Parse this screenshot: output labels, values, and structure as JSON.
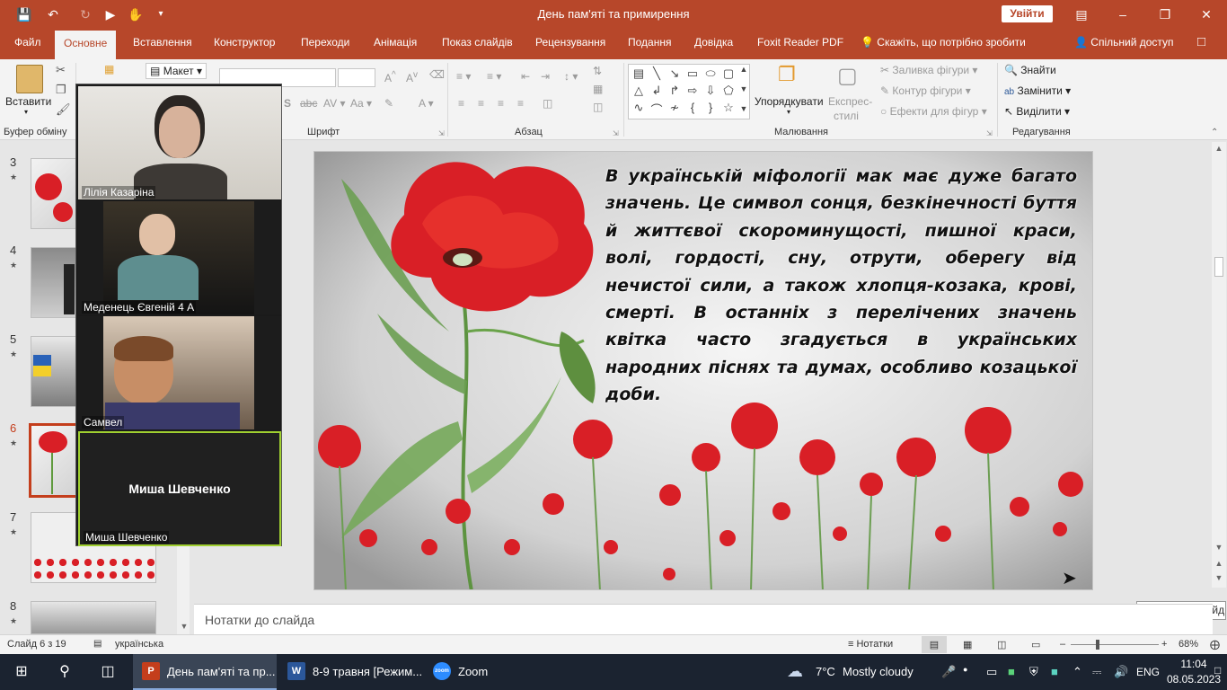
{
  "titlebar": {
    "title": "День пам'яті та примирення",
    "signin_label": "Увійти"
  },
  "tabs": [
    {
      "label": "Файл"
    },
    {
      "label": "Основне"
    },
    {
      "label": "Вставлення"
    },
    {
      "label": "Конструктор"
    },
    {
      "label": "Переходи"
    },
    {
      "label": "Анімація"
    },
    {
      "label": "Показ слайдів"
    },
    {
      "label": "Рецензування"
    },
    {
      "label": "Подання"
    },
    {
      "label": "Довідка"
    },
    {
      "label": "Foxit Reader PDF"
    }
  ],
  "tell_me": "Скажіть, що потрібно зробити",
  "share": "Спільний доступ",
  "ribbon": {
    "paste": "Вставити",
    "layout": "Макет",
    "arrange": "Упорядкувати",
    "quick_styles_1": "Експрес-",
    "quick_styles_2": "стилі",
    "shape_fill": "Заливка фігури",
    "shape_outline": "Контур фігури",
    "shape_effects": "Ефекти для фігур",
    "find": "Знайти",
    "replace": "Замінити",
    "select": "Виділити",
    "groups": {
      "clipboard": "Буфер обміну",
      "font": "Шрифт",
      "paragraph": "Абзац",
      "drawing": "Малювання",
      "editing": "Редагування"
    }
  },
  "thumbnails": [
    {
      "num": "3"
    },
    {
      "num": "4"
    },
    {
      "num": "5"
    },
    {
      "num": "6"
    },
    {
      "num": "7"
    },
    {
      "num": "8"
    }
  ],
  "participants": [
    {
      "name": "Лілія Казаріна"
    },
    {
      "name": "Меденець Євгеній 4 А"
    },
    {
      "name": "Самвел"
    },
    {
      "name": "Миша Шевченко"
    }
  ],
  "slide": {
    "text": "В українській міфології мак має дуже багато значень. Це символ сонця, безкінечності буття й життєвої скороминущості, пишної краси, волі, гордості, сну, отрути, оберегу від нечистої сили, а також хлопця-козака, крові, смерті. В останніх з перелічених значень квітка часто згадується в українських народних піснях та думах, особливо козацької доби."
  },
  "tooltip": "Наступний слайд",
  "notes_placeholder": "Нотатки до слайда",
  "status": {
    "slide_info": "Слайд 6 з 19",
    "language": "українська",
    "notes": "Нотатки",
    "zoom": "68%"
  },
  "taskbar": {
    "apps": [
      {
        "label": "День пам'яті та пр..."
      },
      {
        "label": "8-9 травня [Режим..."
      },
      {
        "label": "Zoom"
      }
    ],
    "weather_temp": "7°C",
    "weather_desc": "Mostly cloudy",
    "lang": "ENG",
    "time": "11:04",
    "date": "08.05.2023"
  },
  "colors": {
    "accent": "#b7472a",
    "taskbar": "#1b2330",
    "poppy_red": "#d91f26"
  }
}
